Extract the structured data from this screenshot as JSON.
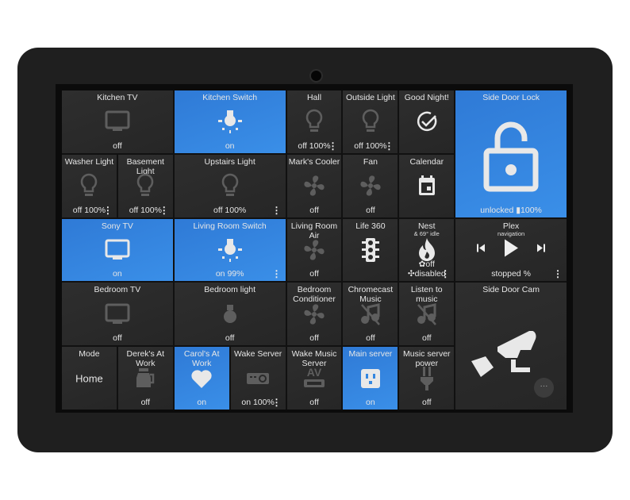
{
  "colors": {
    "active": "#3487e0",
    "inactive": "#2a2a2a",
    "frame": "#1f1f1f"
  },
  "tiles": [
    {
      "id": "kitchen-tv",
      "title": "Kitchen TV",
      "status": "off",
      "icon": "tv-icon",
      "state": "off",
      "col": "1 / span 2",
      "row": "1"
    },
    {
      "id": "kitchen-switch",
      "title": "Kitchen Switch",
      "status": "on",
      "icon": "bulb-on-icon",
      "state": "on",
      "col": "3 / span 2",
      "row": "1"
    },
    {
      "id": "hall",
      "title": "Hall",
      "status": "off 100%",
      "icon": "bulb-icon",
      "state": "off",
      "col": "5",
      "row": "1",
      "menu": true
    },
    {
      "id": "outside-light",
      "title": "Outside Light",
      "status": "off 100%",
      "icon": "bulb-icon",
      "state": "off",
      "col": "6",
      "row": "1",
      "menu": true
    },
    {
      "id": "good-night",
      "title": "Good Night!",
      "status": "",
      "icon": "check-circle-icon",
      "state": "off",
      "col": "7",
      "row": "1"
    },
    {
      "id": "side-door-lock",
      "title": "Side Door Lock",
      "status": "unlocked ▮100%",
      "icon": "lock-open-icon",
      "state": "on",
      "col": "8 / span 2",
      "row": "1 / span 2"
    },
    {
      "id": "washer-light",
      "title": "Washer Light",
      "status": "off 100%",
      "icon": "bulb-icon",
      "state": "off",
      "col": "1",
      "row": "2",
      "menu": true
    },
    {
      "id": "basement-light",
      "title": "Basement Light",
      "status": "off 100%",
      "icon": "bulb-icon",
      "state": "off",
      "col": "2",
      "row": "2",
      "menu": true
    },
    {
      "id": "upstairs-light",
      "title": "Upstairs Light",
      "status": "off 100%",
      "icon": "bulb-icon",
      "state": "off",
      "col": "3 / span 2",
      "row": "2",
      "menu": true
    },
    {
      "id": "marks-cooler",
      "title": "Mark's Cooler",
      "status": "off",
      "icon": "fan-icon",
      "state": "off",
      "col": "5",
      "row": "2"
    },
    {
      "id": "fan",
      "title": "Fan",
      "status": "off",
      "icon": "fan-icon",
      "state": "off",
      "col": "6",
      "row": "2"
    },
    {
      "id": "calendar",
      "title": "Calendar",
      "status": "",
      "icon": "calendar-icon",
      "state": "off",
      "col": "7",
      "row": "2"
    },
    {
      "id": "sony-tv",
      "title": "Sony TV",
      "status": "on",
      "icon": "tv-on-icon",
      "state": "on",
      "col": "1 / span 2",
      "row": "3"
    },
    {
      "id": "living-room-switch",
      "title": "Living Room Switch",
      "status": "on 99%",
      "icon": "bulb-on-icon",
      "state": "on",
      "col": "3 / span 2",
      "row": "3",
      "menu": true
    },
    {
      "id": "living-room-air",
      "title": "Living Room Air",
      "status": "off",
      "icon": "fan-icon",
      "state": "off",
      "col": "5",
      "row": "3"
    },
    {
      "id": "life-360",
      "title": "Life 360",
      "status": "",
      "icon": "traffic-light-icon",
      "state": "off",
      "col": "6",
      "row": "3"
    },
    {
      "id": "nest",
      "title": "Nest",
      "subtitle": "& 69° idle",
      "status": "✿off ✣disabled",
      "icon": "flame-icon",
      "state": "off",
      "col": "7",
      "row": "3",
      "menu": true
    },
    {
      "id": "plex",
      "title": "Plex",
      "subtitle": "navigation",
      "status": "stopped %",
      "icon": "plex",
      "state": "off",
      "col": "8 / span 2",
      "row": "3",
      "menu": true
    },
    {
      "id": "bedroom-tv",
      "title": "Bedroom TV",
      "status": "off",
      "icon": "tv-icon",
      "state": "off",
      "col": "1 / span 2",
      "row": "4"
    },
    {
      "id": "bedroom-light",
      "title": "Bedroom light",
      "status": "off",
      "icon": "bulb-solid-icon",
      "state": "off",
      "col": "3 / span 2",
      "row": "4"
    },
    {
      "id": "bedroom-conditioner",
      "title": "Bedroom Conditioner",
      "status": "off",
      "icon": "fan-icon",
      "state": "off",
      "col": "5",
      "row": "4"
    },
    {
      "id": "chromecast-music",
      "title": "Chromecast Music",
      "status": "off",
      "icon": "music-off-icon",
      "state": "off",
      "col": "6",
      "row": "4"
    },
    {
      "id": "listen-to-music",
      "title": "Listen to music",
      "status": "off",
      "icon": "music-off-icon",
      "state": "off",
      "col": "7",
      "row": "4"
    },
    {
      "id": "side-door-cam",
      "title": "Side Door Cam",
      "status": "",
      "icon": "cctv-icon",
      "state": "off",
      "col": "8 / span 2",
      "row": "4 / span 2",
      "more": "···"
    },
    {
      "id": "mode",
      "title": "Mode",
      "value": "Home",
      "status": "",
      "icon": "",
      "state": "off",
      "col": "1",
      "row": "5"
    },
    {
      "id": "dereks-at-work",
      "title": "Derek's At Work",
      "status": "off",
      "icon": "coffee-pot-icon",
      "state": "off",
      "col": "2",
      "row": "5"
    },
    {
      "id": "carols-at-work",
      "title": "Carol's At Work",
      "status": "on",
      "icon": "heart-icon",
      "state": "on",
      "col": "3",
      "row": "5"
    },
    {
      "id": "wake-server",
      "title": "Wake Server",
      "status": "on 100%",
      "icon": "projector-icon",
      "state": "off",
      "col": "4",
      "row": "5",
      "menu": true
    },
    {
      "id": "wake-music-server",
      "title": "Wake Music Server",
      "status": "off",
      "icon": "av-receiver-icon",
      "state": "off",
      "col": "5",
      "row": "5"
    },
    {
      "id": "main-server",
      "title": "Main server",
      "status": "on",
      "icon": "outlet-icon",
      "state": "on",
      "col": "6",
      "row": "5"
    },
    {
      "id": "music-server-power",
      "title": "Music server power",
      "status": "off",
      "icon": "plug-icon",
      "state": "off",
      "col": "7",
      "row": "5"
    }
  ]
}
